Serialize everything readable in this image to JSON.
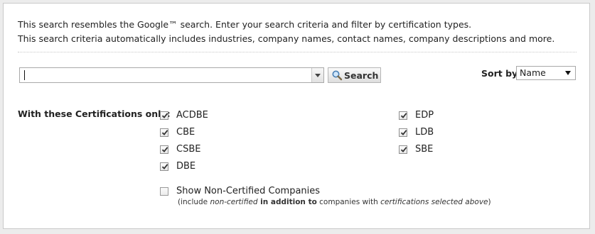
{
  "intro": {
    "line1": "This search resembles the Google™ search. Enter your search criteria and filter by certification types.",
    "line2": "This search criteria automatically includes industries, company names, contact names, company descriptions and more."
  },
  "search": {
    "value": "",
    "button_label": "Search"
  },
  "sort": {
    "label": "Sort by",
    "selected": "Name"
  },
  "certifications": {
    "label": "With these Certifications only:",
    "left": [
      {
        "label": "ACDBE",
        "checked": true
      },
      {
        "label": "CBE",
        "checked": true
      },
      {
        "label": "CSBE",
        "checked": true
      },
      {
        "label": "DBE",
        "checked": true
      }
    ],
    "right": [
      {
        "label": "EDP",
        "checked": true
      },
      {
        "label": "LDB",
        "checked": true
      },
      {
        "label": "SBE",
        "checked": true
      }
    ]
  },
  "non_certified": {
    "label": "Show Non-Certified Companies",
    "checked": false,
    "note_open": "(include ",
    "note_em1": "non-certified",
    "note_bold": " in addition to",
    "note_mid": " companies with ",
    "note_em2": "certifications selected above",
    "note_close": ")"
  }
}
